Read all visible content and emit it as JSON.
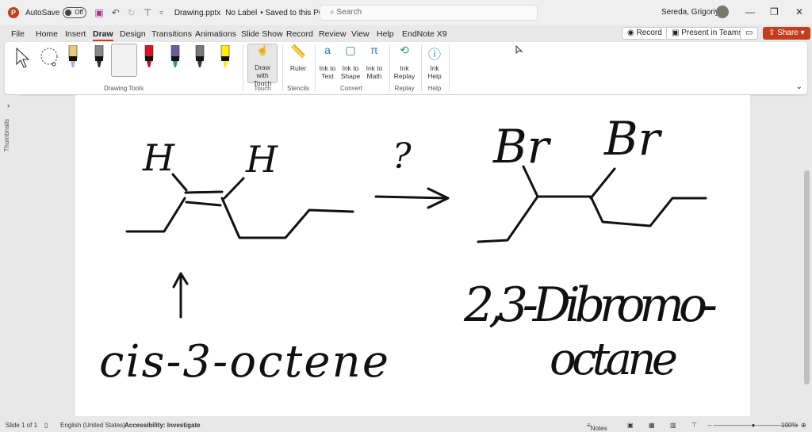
{
  "titlebar": {
    "autosave_label": "AutoSave",
    "autosave_state": "Off",
    "filename": "Drawing.pptx",
    "label_status": "No Label",
    "save_status": "• Saved to this PC",
    "search_placeholder": "Search",
    "user": "Sereda, Grigoriy A"
  },
  "menu": {
    "tabs": [
      "File",
      "Home",
      "Insert",
      "Draw",
      "Design",
      "Transitions",
      "Animations",
      "Slide Show",
      "Record",
      "Review",
      "View",
      "Help",
      "EndNote X9"
    ],
    "active": "Draw",
    "record": "Record",
    "present": "Present in Teams",
    "share": "Share"
  },
  "ribbon": {
    "groups": {
      "drawing_tools": "Drawing Tools",
      "touch": "Touch",
      "stencils": "Stencils",
      "convert": "Convert",
      "replay": "Replay",
      "help": "Help"
    },
    "buttons": {
      "draw_touch": "Draw with Touch",
      "ruler": "Ruler",
      "ink_text": "Ink to Text",
      "ink_shape": "Ink to Shape",
      "ink_math": "Ink to Math",
      "ink_replay": "Ink Replay",
      "ink_help": "Ink Help"
    },
    "pens": [
      {
        "color": "#e8c87a",
        "tip": "#c8a0d8"
      },
      {
        "color": "#888888",
        "tip": "#333333"
      },
      {
        "color": "#000000",
        "tip": "#000000"
      },
      {
        "color": "#e01020",
        "tip": "#c01020"
      },
      {
        "color": "#6a5aa0",
        "tip": "#2a9a8a"
      },
      {
        "color": "#777777",
        "tip": "#333333"
      },
      {
        "color": "#ffee00",
        "tip": "#ffee00"
      }
    ]
  },
  "sidebar": {
    "thumbnails": "Thumbnails"
  },
  "slide": {
    "h1": "H",
    "h2": "H",
    "question": "?",
    "br1": "Br",
    "br2": "Br",
    "reactant": "cis-3-octene",
    "product_line1": "2,3-Dibromo-",
    "product_line2": "octane"
  },
  "status": {
    "slide": "Slide 1 of 1",
    "language": "English (United States)",
    "accessibility": "Accessibility: Investigate",
    "notes": "Notes",
    "zoom": "100%"
  }
}
